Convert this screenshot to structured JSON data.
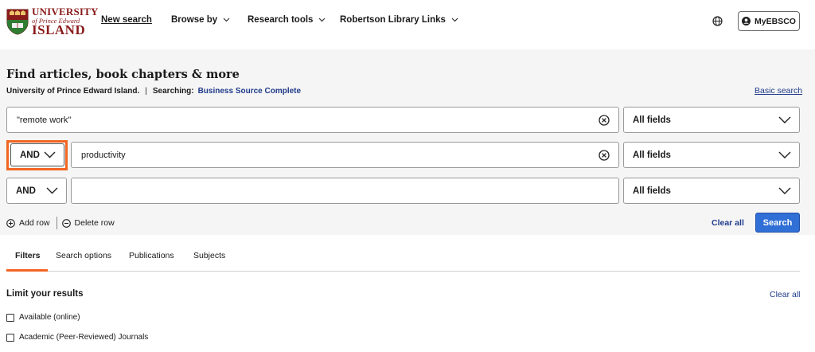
{
  "logo": {
    "line1": "UNIVERSITY",
    "line2": "of Prince Edward",
    "line3": "ISLAND"
  },
  "nav": {
    "new_search": "New search",
    "browse_by": "Browse by",
    "research_tools": "Research tools",
    "robertson": "Robertson Library Links"
  },
  "header": {
    "myebsco": "MyEBSCO",
    "globe_icon": "globe-icon",
    "user_icon": "user-circle-icon"
  },
  "page": {
    "title": "Find articles, book chapters & more",
    "institution": "University of Prince Edward Island.",
    "separator": "|",
    "searching_label": "Searching:",
    "database": "Business Source Complete",
    "basic_search": "Basic search"
  },
  "rows": [
    {
      "operator": "",
      "query": "\"remote work\"",
      "field": "All fields"
    },
    {
      "operator": "AND",
      "query": "productivity",
      "field": "All fields"
    },
    {
      "operator": "AND",
      "query": "",
      "field": "All fields"
    }
  ],
  "actions": {
    "add_row": "Add row",
    "delete_row": "Delete row",
    "clear_all": "Clear all",
    "search": "Search"
  },
  "tabs": [
    "Filters",
    "Search options",
    "Publications",
    "Subjects"
  ],
  "filters": {
    "heading": "Limit your results",
    "clear_all": "Clear all",
    "options": [
      "Available (online)",
      "Academic (Peer-Reviewed) Journals"
    ]
  },
  "colors": {
    "accent": "#f26522",
    "link": "#1f3a8a",
    "primary_button": "#2f6fd6",
    "brand": "#8a1b1b"
  }
}
